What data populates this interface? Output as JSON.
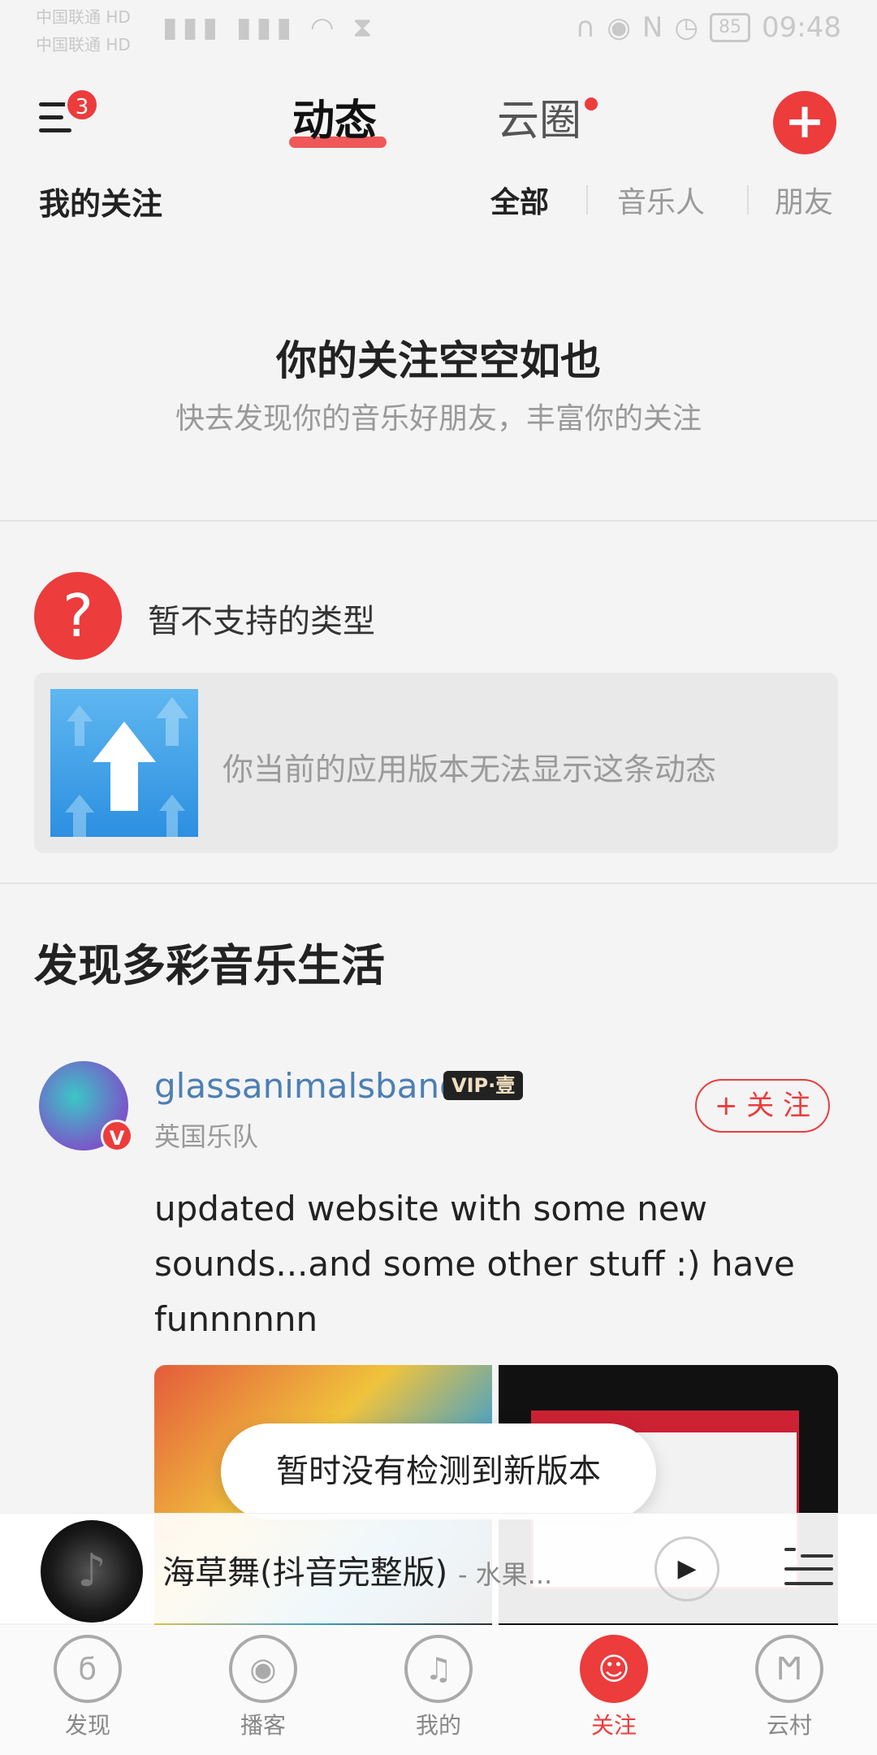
{
  "status_bar": {
    "carrier1": "中国联通 HD",
    "carrier2": "中国联通 HD",
    "battery": "85",
    "time": "09:48"
  },
  "header": {
    "menu_badge": "3",
    "tab_dongtai": "动态",
    "tab_yunquan": "云圈",
    "add_icon": "plus-icon"
  },
  "subnav": {
    "my_follow": "我的关注",
    "filters": [
      "全部",
      "音乐人",
      "朋友"
    ]
  },
  "empty": {
    "title": "你的关注空空如也",
    "subtitle": "快去发现你的音乐好朋友，丰富你的关注"
  },
  "unsupported": {
    "title": "暂不支持的类型",
    "message": "你当前的应用版本无法显示这条动态"
  },
  "discover": {
    "title": "发现多彩音乐生活",
    "post": {
      "username": "glassanimalsband",
      "vip": "VIP·壹",
      "description": "英国乐队",
      "follow_label": "+ 关 注",
      "text": "updated website with some new sounds...and some other stuff :) have funnnnnn"
    }
  },
  "toast": "暂时没有检测到新版本",
  "player": {
    "song": "海草舞(抖音完整版)",
    "artist": "- 水果..."
  },
  "bottom_nav": [
    {
      "label": "发现",
      "icon": "discover-icon"
    },
    {
      "label": "播客",
      "icon": "podcast-icon"
    },
    {
      "label": "我的",
      "icon": "music-note-icon"
    },
    {
      "label": "关注",
      "icon": "follow-icon"
    },
    {
      "label": "云村",
      "icon": "cloud-village-icon"
    }
  ],
  "colors": {
    "accent": "#ec3c3c",
    "background": "#f4f4f5",
    "link": "#4c7fb3"
  }
}
